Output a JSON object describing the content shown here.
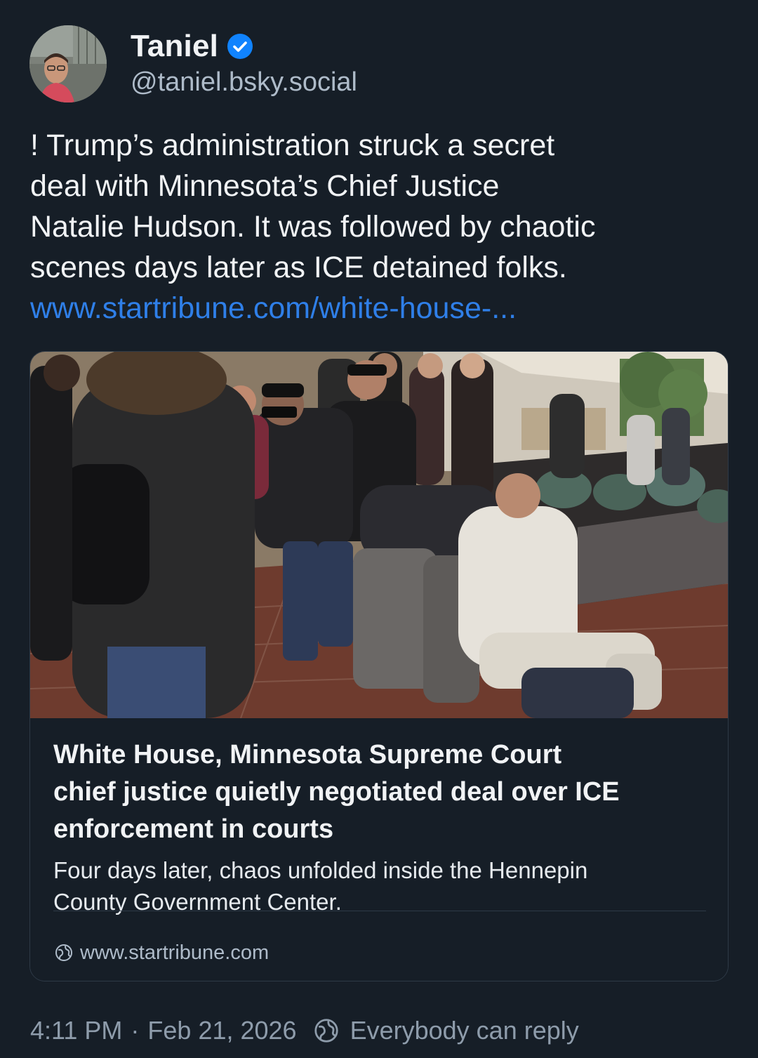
{
  "author": {
    "display_name": "Taniel",
    "handle": "@taniel.bsky.social",
    "verified": true,
    "badge_color": "#1083fe"
  },
  "post": {
    "text_lines": [
      "! Trump’s administration struck a secret",
      "deal with Minnesota’s Chief Justice",
      "Natalie Hudson. It was followed by chaotic",
      "scenes days later as ICE detained folks."
    ],
    "link_text": "www.startribune.com/white-house-..."
  },
  "link_card": {
    "title_lines": [
      "White House, Minnesota Supreme Court",
      "chief justice quietly negotiated deal over ICE",
      "enforcement in courts"
    ],
    "description_lines": [
      "Four days later, chaos unfolded inside the Hennepin",
      "County Government Center."
    ],
    "domain": "www.startribune.com",
    "globe_icon": "globe-icon"
  },
  "footer": {
    "time": "4:11 PM",
    "separator": "·",
    "date": "Feb 21, 2026",
    "reply_setting": "Everybody can reply",
    "reply_icon": "globe-icon"
  },
  "colors": {
    "background": "#161e27",
    "link": "#2f7fe8",
    "secondary_text": "#aebbc9",
    "meta_text": "#8e9cab"
  }
}
